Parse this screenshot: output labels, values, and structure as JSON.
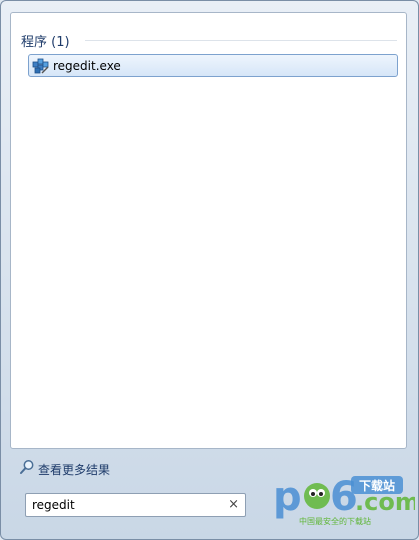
{
  "results": {
    "group_header": "程序 (1)",
    "items": [
      {
        "label": "regedit.exe",
        "icon": "registry-editor-icon"
      }
    ]
  },
  "more_results": {
    "label": "查看更多结果",
    "icon": "search-icon"
  },
  "search": {
    "value": "regedit",
    "clear_icon": "×"
  },
  "watermark": {
    "brand": "pc6.com",
    "tag": "下载站",
    "slogan": "中国最安全的下载站"
  },
  "colors": {
    "header_text": "#1e3b6a",
    "selection_border": "#7da2ce",
    "brand_blue": "#4a8fd4",
    "brand_green": "#5fb636"
  }
}
